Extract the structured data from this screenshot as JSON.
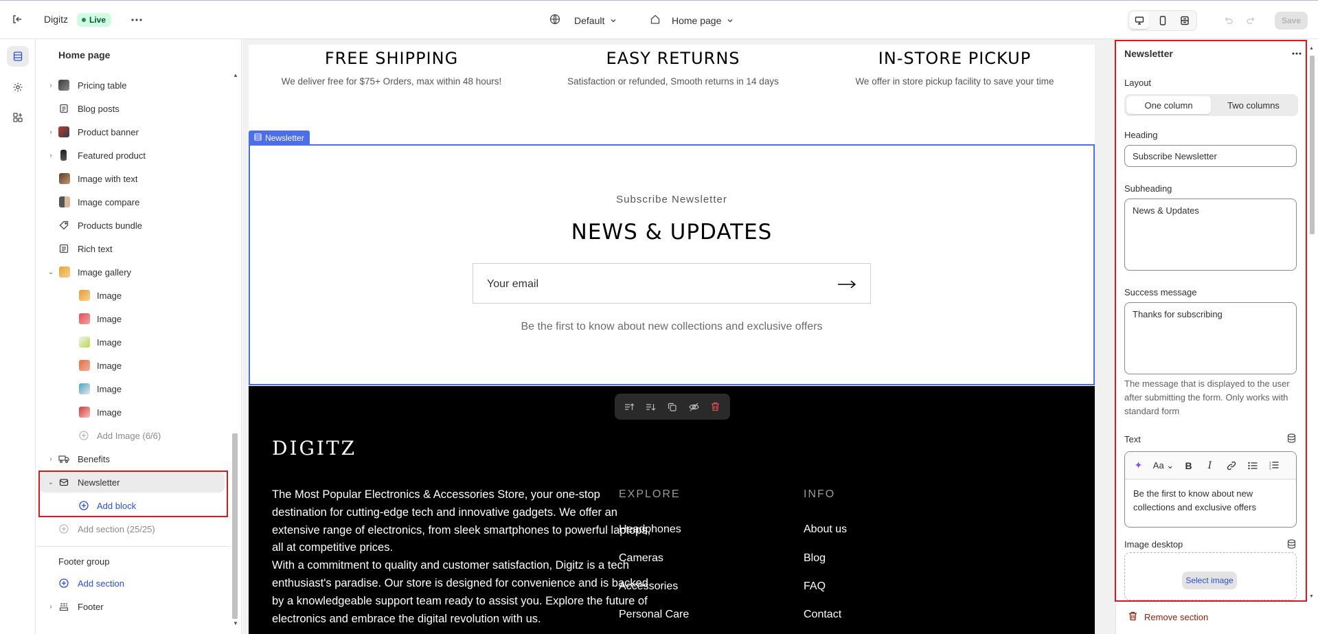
{
  "topbar": {
    "store_name": "Digitz",
    "status_badge": "Live",
    "theme_dropdown": "Default",
    "page_dropdown": "Home page",
    "save_label": "Save"
  },
  "sidebar": {
    "title": "Home page",
    "items": [
      {
        "label": "Pricing table"
      },
      {
        "label": "Blog posts"
      },
      {
        "label": "Product banner"
      },
      {
        "label": "Featured product"
      },
      {
        "label": "Image with text"
      },
      {
        "label": "Image compare"
      },
      {
        "label": "Products bundle"
      },
      {
        "label": "Rich text"
      },
      {
        "label": "Image gallery"
      },
      {
        "label": "Image"
      },
      {
        "label": "Image"
      },
      {
        "label": "Image"
      },
      {
        "label": "Image"
      },
      {
        "label": "Image"
      },
      {
        "label": "Image"
      },
      {
        "label": "Add Image (6/6)"
      },
      {
        "label": "Benefits"
      },
      {
        "label": "Newsletter"
      },
      {
        "label": "Add block"
      },
      {
        "label": "Add section (25/25)"
      }
    ],
    "footer_group_title": "Footer group",
    "add_section_label": "Add section",
    "footer_label": "Footer"
  },
  "preview": {
    "features": [
      {
        "title": "FREE SHIPPING",
        "text": "We deliver free for $75+ Orders, max within 48 hours!"
      },
      {
        "title": "EASY RETURNS",
        "text": "Satisfaction or refunded, Smooth returns in 14 days"
      },
      {
        "title": "IN-STORE PICKUP",
        "text": "We offer in store pickup facility to save your time"
      }
    ],
    "newsletter_tag": "Newsletter",
    "newsletter": {
      "subheading": "Subscribe Newsletter",
      "heading": "NEWS & UPDATES",
      "email_placeholder": "Your email",
      "note": "Be the first to know about new collections and exclusive offers"
    },
    "footer": {
      "logo": "DIGITZ",
      "paragraph1": "The Most Popular Electronics & Accessories Store, your one-stop destination for cutting-edge tech and innovative gadgets. We offer an extensive range of electronics, from sleek smartphones to powerful laptops, all at competitive prices.",
      "paragraph2": "With a commitment to quality and customer satisfaction, Digitz is a tech enthusiast's paradise. Our store is designed for convenience and is backed by a knowledgeable support team ready to assist you. Explore the future of electronics and embrace the digital revolution with us.",
      "explore_heading": "EXPLORE",
      "explore_links": [
        "Headphones",
        "Cameras",
        "Accessories",
        "Personal Care"
      ],
      "info_heading": "INFO",
      "info_links": [
        "About us",
        "Blog",
        "FAQ",
        "Contact"
      ]
    }
  },
  "settings": {
    "title": "Newsletter",
    "layout_label": "Layout",
    "layout_options": [
      "One column",
      "Two columns"
    ],
    "layout_selected": "One column",
    "heading_label": "Heading",
    "heading_value": "Subscribe Newsletter",
    "subheading_label": "Subheading",
    "subheading_value": "News & Updates",
    "success_label": "Success message",
    "success_value": "Thanks for subscribing",
    "success_help": "The message that is displayed to the user after submitting the form. Only works with standard form",
    "text_label": "Text",
    "text_value": "Be the first to know about new collections and exclusive offers",
    "image_desktop_label": "Image desktop",
    "select_image_label": "Select image",
    "remove_section_label": "Remove section"
  },
  "colors": {
    "accent": "#2c4fd6",
    "selection": "#4d6ee9",
    "highlight_box": "#e3151a",
    "live_badge": "#cdfee1"
  }
}
